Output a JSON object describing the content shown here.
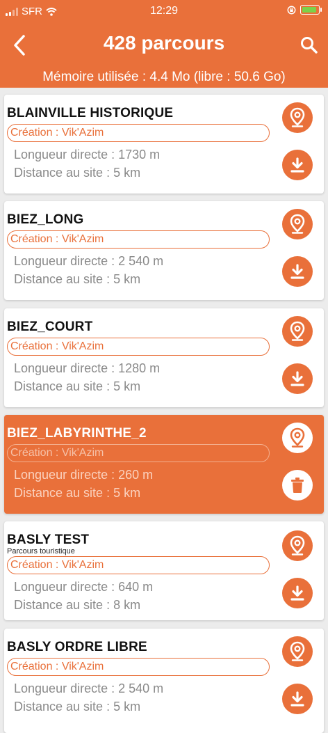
{
  "status_bar": {
    "carrier": "SFR",
    "time": "12:29"
  },
  "header": {
    "title": "428 parcours",
    "memory": "Mémoire utilisée : 4.4 Mo (libre : 50.6 Go)"
  },
  "icons": {
    "back": "chevron-left-icon",
    "search": "search-icon",
    "map": "map-pin-icon",
    "download": "download-icon",
    "delete": "trash-icon"
  },
  "colors": {
    "accent": "#e9703a",
    "background": "#ececec"
  },
  "routes": [
    {
      "title": "BLAINVILLE HISTORIQUE",
      "subtitle": "",
      "creator": "Création : Vik'Azim",
      "length": "Longueur directe : 1730 m",
      "distance": "Distance au site : 5 km",
      "selected": false,
      "action": "download"
    },
    {
      "title": "BIEZ_LONG",
      "subtitle": "",
      "creator": "Création : Vik'Azim",
      "length": "Longueur directe : 2 540 m",
      "distance": "Distance au site : 5 km",
      "selected": false,
      "action": "download"
    },
    {
      "title": "BIEZ_COURT",
      "subtitle": "",
      "creator": "Création : Vik'Azim",
      "length": "Longueur directe : 1280 m",
      "distance": "Distance au site : 5 km",
      "selected": false,
      "action": "download"
    },
    {
      "title": "BIEZ_LABYRINTHE_2",
      "subtitle": "",
      "creator": "Création : Vik'Azim",
      "length": "Longueur directe : 260 m",
      "distance": "Distance au site : 5 km",
      "selected": true,
      "action": "delete"
    },
    {
      "title": "BASLY TEST",
      "subtitle": "Parcours touristique",
      "creator": "Création : Vik'Azim",
      "length": "Longueur directe : 640 m",
      "distance": "Distance au site : 8 km",
      "selected": false,
      "action": "download"
    },
    {
      "title": "BASLY ORDRE LIBRE",
      "subtitle": "",
      "creator": "Création : Vik'Azim",
      "length": "Longueur directe : 2 540 m",
      "distance": "Distance au site : 5 km",
      "selected": false,
      "action": "download"
    }
  ]
}
